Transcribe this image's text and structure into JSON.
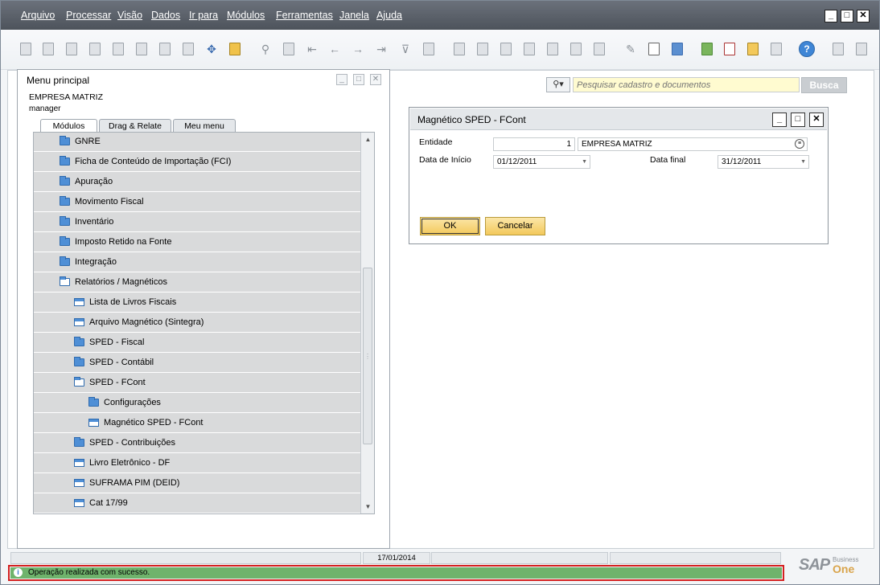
{
  "menubar": {
    "items": [
      "Arquivo",
      "Processar",
      "Visão",
      "Dados",
      "Ir para",
      "Módulos",
      "Ferramentas",
      "Janela",
      "Ajuda"
    ]
  },
  "window_controls": {
    "minimize": "_",
    "restore": "□",
    "close": "✕"
  },
  "search": {
    "button_icon": "search-icon",
    "placeholder": "Pesquisar cadastro e documentos",
    "go_label": "Busca"
  },
  "menu_panel": {
    "title": "Menu principal",
    "company": "EMPRESA MATRIZ",
    "user": "manager",
    "tabs": [
      "Módulos",
      "Drag & Relate",
      "Meu menu"
    ],
    "active_tab": "Módulos",
    "items": [
      {
        "label": "GNRE",
        "icon": "folder-icon",
        "level": 0
      },
      {
        "label": "Ficha de Conteúdo de Importação (FCI)",
        "icon": "folder-icon",
        "level": 0
      },
      {
        "label": "Apuração",
        "icon": "folder-icon",
        "level": 0
      },
      {
        "label": "Movimento Fiscal",
        "icon": "folder-icon",
        "level": 0
      },
      {
        "label": "Inventário",
        "icon": "folder-icon",
        "level": 0
      },
      {
        "label": "Imposto Retido na Fonte",
        "icon": "folder-icon",
        "level": 0
      },
      {
        "label": "Integração",
        "icon": "folder-icon",
        "level": 0
      },
      {
        "label": "Relatórios / Magnéticos",
        "icon": "folder-open-icon",
        "level": 0
      },
      {
        "label": "Lista de Livros Fiscais",
        "icon": "document-icon",
        "level": 1
      },
      {
        "label": "Arquivo Magnético (Sintegra)",
        "icon": "document-icon",
        "level": 1
      },
      {
        "label": "SPED - Fiscal",
        "icon": "folder-icon",
        "level": 1
      },
      {
        "label": "SPED - Contábil",
        "icon": "folder-icon",
        "level": 1
      },
      {
        "label": "SPED - FCont",
        "icon": "folder-open-icon",
        "level": 1
      },
      {
        "label": "Configurações",
        "icon": "folder-icon",
        "level": 2
      },
      {
        "label": "Magnético SPED - FCont",
        "icon": "document-icon",
        "level": 2
      },
      {
        "label": "SPED - Contribuições",
        "icon": "folder-icon",
        "level": 1
      },
      {
        "label": "Livro Eletrônico - DF",
        "icon": "document-icon",
        "level": 1
      },
      {
        "label": "SUFRAMA PIM (DEID)",
        "icon": "document-icon",
        "level": 1
      },
      {
        "label": "Cat 17/99",
        "icon": "document-icon",
        "level": 1
      }
    ]
  },
  "dialog": {
    "title": "Magnético SPED - FCont",
    "entidade_label": "Entidade",
    "entidade_code": "1",
    "entidade_name": "EMPRESA MATRIZ",
    "data_inicio_label": "Data de Início",
    "data_inicio_value": "01/12/2011",
    "data_final_label": "Data final",
    "data_final_value": "31/12/2011",
    "ok_label": "OK",
    "cancel_label": "Cancelar"
  },
  "status": {
    "date": "17/01/2014",
    "message": "Operação realizada com sucesso.",
    "message_color": "#6fb36c"
  },
  "brand": {
    "sap": "SAP",
    "business": "Business",
    "one": "One"
  }
}
